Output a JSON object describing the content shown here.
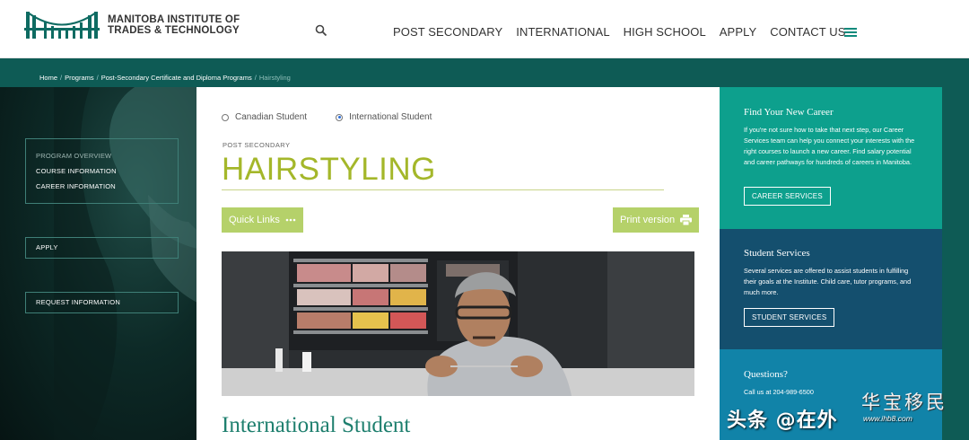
{
  "header": {
    "logo_line1": "MANITOBA INSTITUTE OF",
    "logo_line2": "TRADES & TECHNOLOGY",
    "nav": [
      "POST SECONDARY",
      "INTERNATIONAL",
      "HIGH SCHOOL",
      "APPLY",
      "CONTACT US"
    ],
    "icons": [
      "search-icon",
      "menu-icon"
    ]
  },
  "breadcrumb": {
    "items": [
      "Home",
      "Programs",
      "Post-Secondary Certificate and Diploma Programs"
    ],
    "separator": "/",
    "current": "Hairstyling"
  },
  "sidebar": {
    "program_overview": "PROGRAM OVERVIEW",
    "course_information": "COURSE INFORMATION",
    "career_information": "CAREER INFORMATION",
    "apply": "APPLY",
    "request_information": "REQUEST INFORMATION"
  },
  "main": {
    "radio_options": [
      {
        "label": "Canadian Student",
        "selected": false
      },
      {
        "label": "International Student",
        "selected": true
      }
    ],
    "eyebrow": "POST SECONDARY",
    "title": "HAIRSTYLING",
    "quick_links": "Quick Links",
    "print_version": "Print version",
    "section_title": "International Student"
  },
  "right": {
    "career": {
      "title": "Find Your New Career",
      "body": "If you're not sure how to take that next step, our Career Services team can help you connect your interests with the right courses to launch a new career. Find salary potential and career pathways for hundreds of careers in Manitoba.",
      "cta": "CAREER SERVICES"
    },
    "student": {
      "title": "Student Services",
      "body": "Several services are offered to assist students in fulfilling their goals at the Institute. Child care, tutor programs, and much more.",
      "cta": "STUDENT SERVICES"
    },
    "questions": {
      "title": "Questions?",
      "body": "Call us at 204-989-6500"
    }
  },
  "watermark": {
    "left": "头条 @在外",
    "right": "华宝移民",
    "url": "www.ihb8.com"
  },
  "colors": {
    "brand_teal": "#0e5b55",
    "title_green": "#a4b72a",
    "button_green": "#b5d16a",
    "card_teal": "#0da08d",
    "card_navy": "#144f6e",
    "card_blue": "#1183a8"
  }
}
